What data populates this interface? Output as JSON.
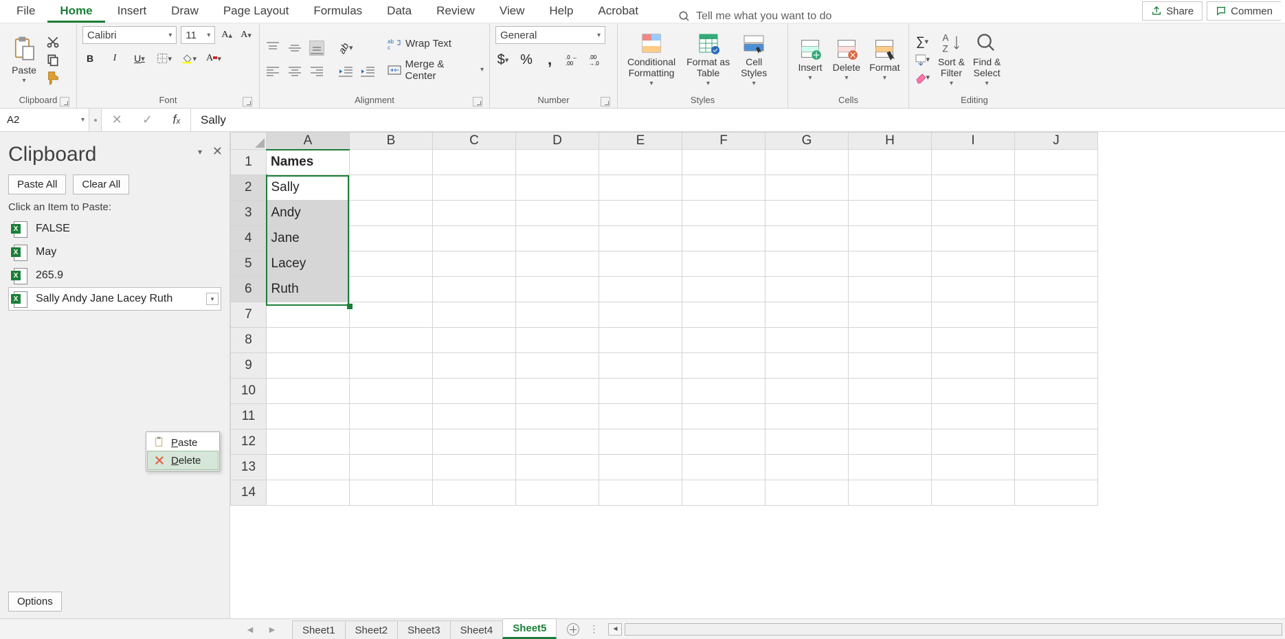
{
  "tabs": {
    "items": [
      "File",
      "Home",
      "Insert",
      "Draw",
      "Page Layout",
      "Formulas",
      "Data",
      "Review",
      "View",
      "Help",
      "Acrobat"
    ],
    "active": "Home",
    "tellme": "Tell me what you want to do",
    "share": "Share",
    "comment": "Commen"
  },
  "ribbon": {
    "clipboard": {
      "label": "Clipboard",
      "paste": "Paste"
    },
    "font": {
      "label": "Font",
      "name": "Calibri",
      "size": "11"
    },
    "alignment": {
      "label": "Alignment",
      "wrap": "Wrap Text",
      "merge": "Merge & Center"
    },
    "number": {
      "label": "Number",
      "format": "General"
    },
    "styles": {
      "label": "Styles",
      "cond": "Conditional\nFormatting",
      "table": "Format as\nTable",
      "cell": "Cell\nStyles"
    },
    "cells": {
      "label": "Cells",
      "insert": "Insert",
      "delete": "Delete",
      "format": "Format"
    },
    "editing": {
      "label": "Editing",
      "sort": "Sort &\nFilter",
      "find": "Find &\nSelect"
    }
  },
  "name_box": "A2",
  "formula": "Sally",
  "pane": {
    "title": "Clipboard",
    "paste_all": "Paste All",
    "clear_all": "Clear All",
    "hint": "Click an Item to Paste:",
    "items": [
      "FALSE",
      "May",
      "265.9",
      "Sally Andy Jane Lacey Ruth"
    ],
    "active_index": 3,
    "ctx_paste": "Paste",
    "ctx_delete": "Delete",
    "options": "Options"
  },
  "grid": {
    "cols": [
      "A",
      "B",
      "C",
      "D",
      "E",
      "F",
      "G",
      "H",
      "I",
      "J"
    ],
    "rowcount": 14,
    "data": {
      "1": {
        "A": "Names"
      },
      "2": {
        "A": "Sally"
      },
      "3": {
        "A": "Andy"
      },
      "4": {
        "A": "Jane"
      },
      "5": {
        "A": "Lacey"
      },
      "6": {
        "A": "Ruth"
      }
    },
    "bold": {
      "1": [
        "A"
      ]
    },
    "sel_col": "A",
    "sel_rows": [
      2,
      3,
      4,
      5,
      6
    ],
    "active_row": 2
  },
  "sheets": {
    "items": [
      "Sheet1",
      "Sheet2",
      "Sheet3",
      "Sheet4",
      "Sheet5"
    ],
    "active": "Sheet5"
  }
}
